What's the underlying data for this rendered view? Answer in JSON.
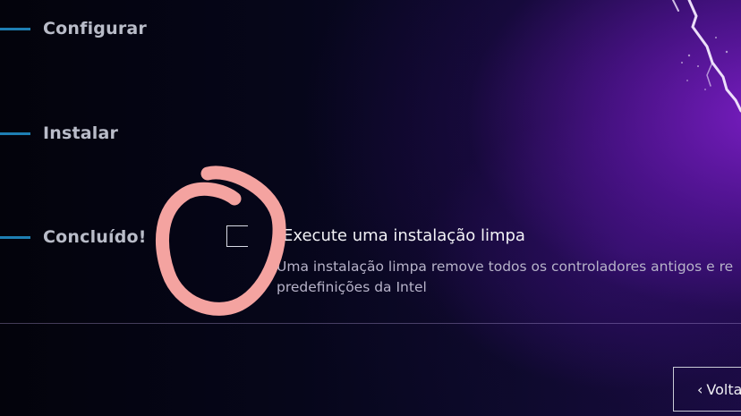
{
  "steps": [
    {
      "label": "Configurar"
    },
    {
      "label": "Instalar"
    },
    {
      "label": "Concluído!"
    }
  ],
  "clean_install": {
    "checked": false,
    "title": "Execute uma instalação limpa",
    "description_line1": "Uma instalação limpa remove todos os controladores antigos e re",
    "description_line2": "predefinições da Intel"
  },
  "buttons": {
    "back_chevron": "‹",
    "back_label": "Volta"
  },
  "colors": {
    "step_accent": "#1e7fb3",
    "annotation": "#f4a3a0"
  }
}
